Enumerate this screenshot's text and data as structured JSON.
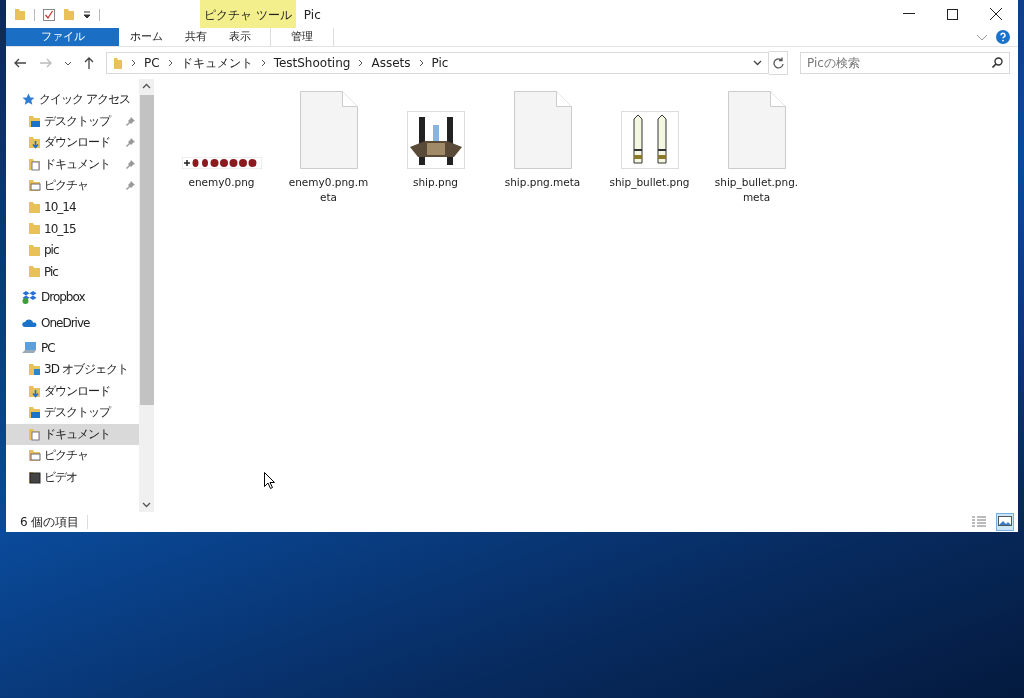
{
  "window": {
    "title": "Pic",
    "context_group": "ピクチャ ツール"
  },
  "ribbon_tabs": [
    {
      "label": "ファイル",
      "kind": "file"
    },
    {
      "label": "ホーム",
      "kind": "normal"
    },
    {
      "label": "共有",
      "kind": "normal"
    },
    {
      "label": "表示",
      "kind": "normal"
    },
    {
      "label": "管理",
      "kind": "context"
    }
  ],
  "address": {
    "crumbs": [
      "PC",
      "ドキュメント",
      "TestShooting",
      "Assets",
      "Pic"
    ]
  },
  "search": {
    "placeholder": "Picの検索"
  },
  "nav": [
    {
      "label": "クイック アクセス",
      "kind": "star",
      "selected": false,
      "children": [
        {
          "label": "デスクトップ",
          "kind": "desktop",
          "pinned": true,
          "selected": false
        },
        {
          "label": "ダウンロード",
          "kind": "download",
          "pinned": true,
          "selected": false
        },
        {
          "label": "ドキュメント",
          "kind": "docs",
          "pinned": true,
          "selected": false
        },
        {
          "label": "ピクチャ",
          "kind": "pictures",
          "pinned": true,
          "selected": false
        },
        {
          "label": "10_14",
          "kind": "folder",
          "pinned": false,
          "selected": false
        },
        {
          "label": "10_15",
          "kind": "folder",
          "pinned": false,
          "selected": false
        },
        {
          "label": "pic",
          "kind": "folder",
          "pinned": false,
          "selected": false
        },
        {
          "label": "Pic",
          "kind": "folder",
          "pinned": false,
          "selected": false
        }
      ]
    },
    {
      "label": "Dropbox",
      "kind": "dropbox",
      "selected": false
    },
    {
      "label": "OneDrive",
      "kind": "cloud",
      "selected": false
    },
    {
      "label": "PC",
      "kind": "pc",
      "selected": false,
      "children": [
        {
          "label": "3D オブジェクト",
          "kind": "cube",
          "pinned": false,
          "selected": false
        },
        {
          "label": "ダウンロード",
          "kind": "download",
          "pinned": false,
          "selected": false
        },
        {
          "label": "デスクトップ",
          "kind": "desktop",
          "pinned": false,
          "selected": false
        },
        {
          "label": "ドキュメント",
          "kind": "docs",
          "pinned": false,
          "selected": true
        },
        {
          "label": "ピクチャ",
          "kind": "pictures",
          "pinned": false,
          "selected": false
        },
        {
          "label": "ビデオ",
          "kind": "video",
          "pinned": false,
          "selected": false
        }
      ]
    }
  ],
  "files": [
    {
      "name": "enemy0.png",
      "kind": "sprite-strip"
    },
    {
      "name": "enemy0.png.meta",
      "kind": "document"
    },
    {
      "name": "ship.png",
      "kind": "ship"
    },
    {
      "name": "ship.png.meta",
      "kind": "document"
    },
    {
      "name": "ship_bullet.png",
      "kind": "bullets"
    },
    {
      "name": "ship_bullet.png.meta",
      "kind": "document"
    }
  ],
  "status_bar": {
    "count": "6 個の項目"
  },
  "view_buttons": [
    {
      "kind": "details",
      "selected": false
    },
    {
      "kind": "large-icons",
      "selected": true
    }
  ]
}
